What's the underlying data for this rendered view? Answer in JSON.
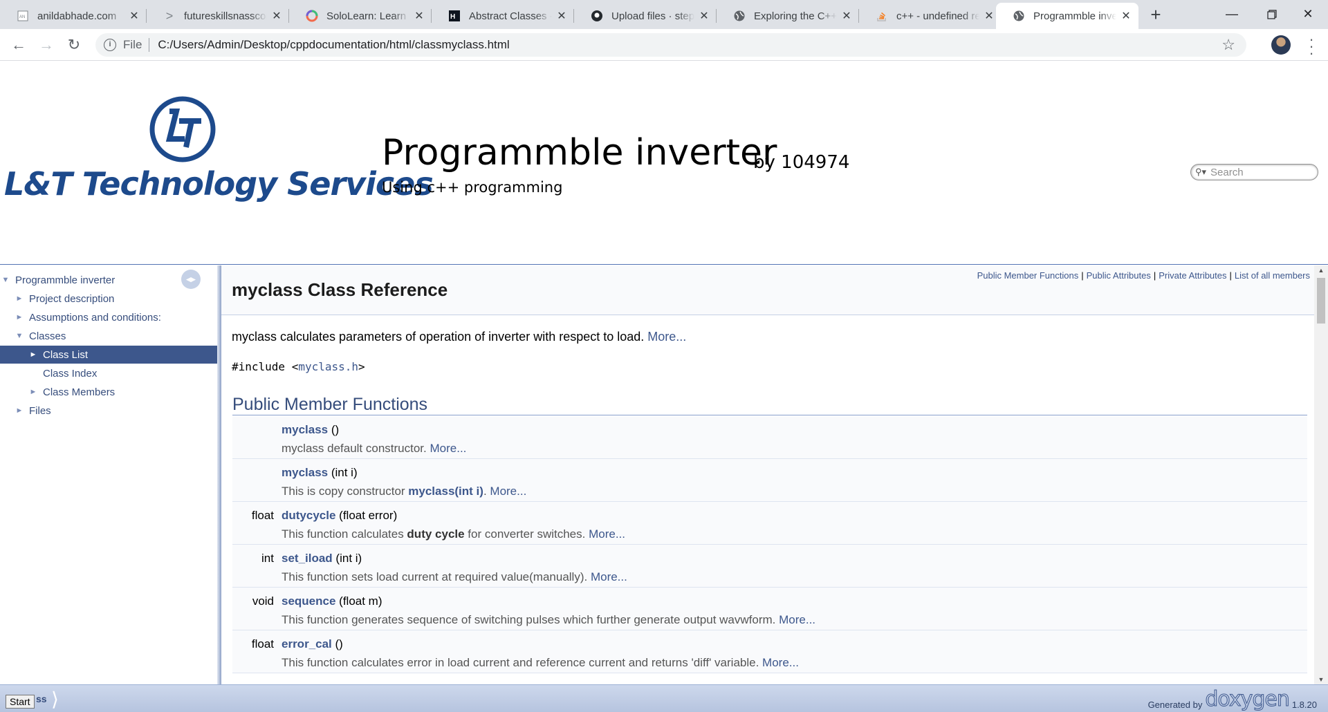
{
  "browser": {
    "tabs": [
      {
        "title": "anildabhade.com",
        "icon": "page-icon"
      },
      {
        "title": "futureskillsnasscom",
        "icon": "chevron-icon"
      },
      {
        "title": "SoloLearn: Learn to",
        "icon": "sololearn-icon"
      },
      {
        "title": "Abstract Classes - ",
        "icon": "hackerrank-icon"
      },
      {
        "title": "Upload files · stepi",
        "icon": "github-icon"
      },
      {
        "title": "Exploring the C++",
        "icon": "globe-icon"
      },
      {
        "title": "c++ - undefined re",
        "icon": "stackoverflow-icon"
      },
      {
        "title": "Programmble inve",
        "icon": "globe-icon"
      }
    ],
    "address": {
      "scheme": "File",
      "url": "C:/Users/Admin/Desktop/cppdocumentation/html/classmyclass.html"
    }
  },
  "titlearea": {
    "logo_text": "L&T Technology Services",
    "project_name": "Programmble inverter",
    "project_number": "by 104974",
    "project_brief": "Using c++ programming",
    "search_placeholder": "Search"
  },
  "sidenav": {
    "items": [
      {
        "label": "Programmble inverter",
        "arrow": "▼",
        "level": 0
      },
      {
        "label": "Project description",
        "arrow": "►",
        "level": 1
      },
      {
        "label": "Assumptions and conditions:",
        "arrow": "►",
        "level": 1
      },
      {
        "label": "Classes",
        "arrow": "▼",
        "level": 1
      },
      {
        "label": "Class List",
        "arrow": "►",
        "level": 2,
        "selected": true
      },
      {
        "label": "Class Index",
        "arrow": "",
        "level": 2
      },
      {
        "label": "Class Members",
        "arrow": "►",
        "level": 2
      },
      {
        "label": "Files",
        "arrow": "►",
        "level": 1
      }
    ]
  },
  "doc": {
    "summary_links": [
      "Public Member Functions",
      "Public Attributes",
      "Private Attributes",
      "List of all members"
    ],
    "title": "myclass Class Reference",
    "brief": "myclass calculates parameters of operation of inverter with respect to load.",
    "more": "More...",
    "include_prefix": "#include <",
    "include_file": "myclass.h",
    "include_suffix": ">",
    "group_title": "Public Member Functions",
    "members": [
      {
        "type": "",
        "name": "myclass",
        "args": " ()",
        "desc_pre": "myclass default constructor.",
        "desc_bold": "",
        "desc_post": ""
      },
      {
        "type": "",
        "name": "myclass",
        "args": " (int i)",
        "desc_pre": "This is copy constructor ",
        "desc_link": "myclass(int i)",
        "desc_post": "."
      },
      {
        "type": "float",
        "name": "dutycycle",
        "args": " (float error)",
        "desc_pre": "This function calculates ",
        "desc_bold": "duty cycle",
        "desc_post": " for converter switches."
      },
      {
        "type": "int",
        "name": "set_iload",
        "args": " (int i)",
        "desc_pre": "This function sets load current at required value(manually).",
        "desc_bold": "",
        "desc_post": ""
      },
      {
        "type": "void",
        "name": "sequence",
        "args": " (float m)",
        "desc_pre": "This function generates sequence of switching pulses which further generate output wavwform.",
        "desc_bold": "",
        "desc_post": ""
      },
      {
        "type": "float",
        "name": "error_cal",
        "args": " ()",
        "desc_pre": "This function calculates error in load current and reference current and returns 'diff' variable.",
        "desc_bold": "",
        "desc_post": ""
      }
    ]
  },
  "navpath": {
    "start": "Start",
    "crumb": "ss",
    "generated_by": "Generated by",
    "generator": "doxygen",
    "version": "1.8.20"
  }
}
